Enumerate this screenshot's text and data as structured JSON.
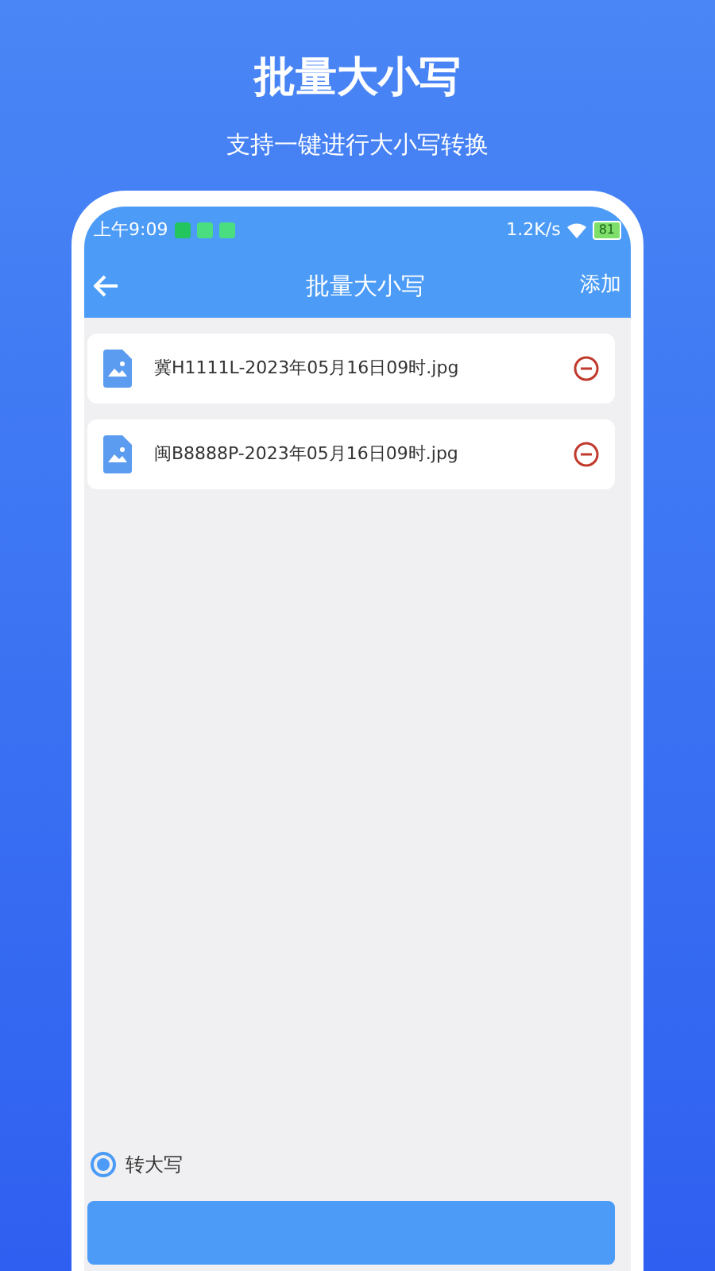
{
  "header": {
    "title": "批量大小写",
    "subtitle": "支持一键进行大小写转换"
  },
  "status_bar": {
    "time": "上午9:09",
    "speed": "1.2K/s",
    "battery": "81"
  },
  "nav": {
    "title": "批量大小写",
    "action": "添加"
  },
  "files": [
    {
      "name": "冀H1111L-2023年05月16日09时.jpg"
    },
    {
      "name": "闽B8888P-2023年05月16日09时.jpg"
    }
  ],
  "options": [
    {
      "label": "转大写",
      "selected": true
    }
  ]
}
